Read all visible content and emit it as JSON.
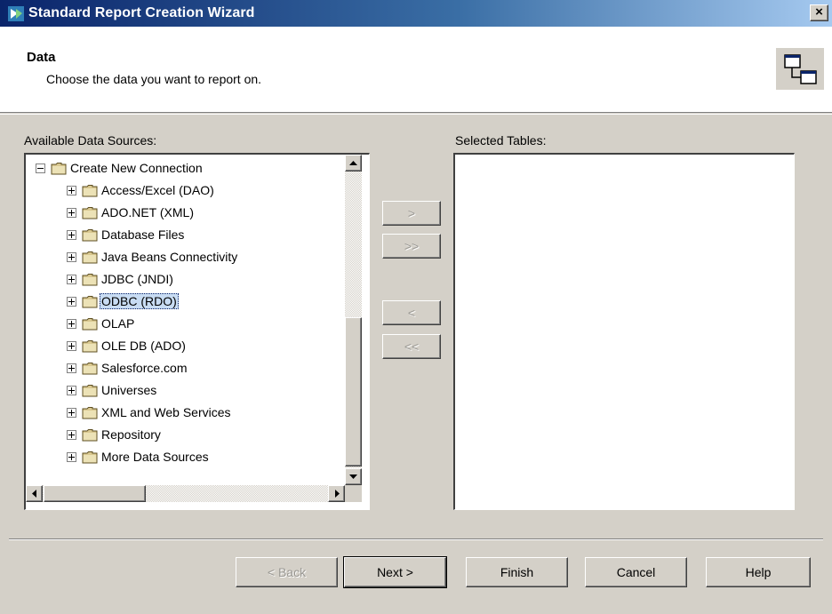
{
  "window": {
    "title": "Standard Report Creation Wizard",
    "close_label": "×"
  },
  "header": {
    "title": "Data",
    "subtitle": "Choose the data you want to report on."
  },
  "available": {
    "label": "Available Data Sources:",
    "root": "Create New Connection",
    "items": [
      {
        "label": "Access/Excel (DAO)"
      },
      {
        "label": "ADO.NET (XML)"
      },
      {
        "label": "Database Files"
      },
      {
        "label": "Java Beans Connectivity"
      },
      {
        "label": "JDBC (JNDI)"
      },
      {
        "label": "ODBC (RDO)",
        "selected": true
      },
      {
        "label": "OLAP"
      },
      {
        "label": "OLE DB (ADO)"
      },
      {
        "label": "Salesforce.com"
      },
      {
        "label": "Universes"
      },
      {
        "label": "XML and Web Services"
      },
      {
        "label": "Repository"
      },
      {
        "label": "More Data Sources"
      }
    ]
  },
  "selected": {
    "label": "Selected Tables:"
  },
  "transfer": {
    "add_one": ">",
    "add_all": ">>",
    "remove_one": "<",
    "remove_all": "<<"
  },
  "footer": {
    "back": "< Back",
    "next": "Next >",
    "finish": "Finish",
    "cancel": "Cancel",
    "help": "Help"
  }
}
